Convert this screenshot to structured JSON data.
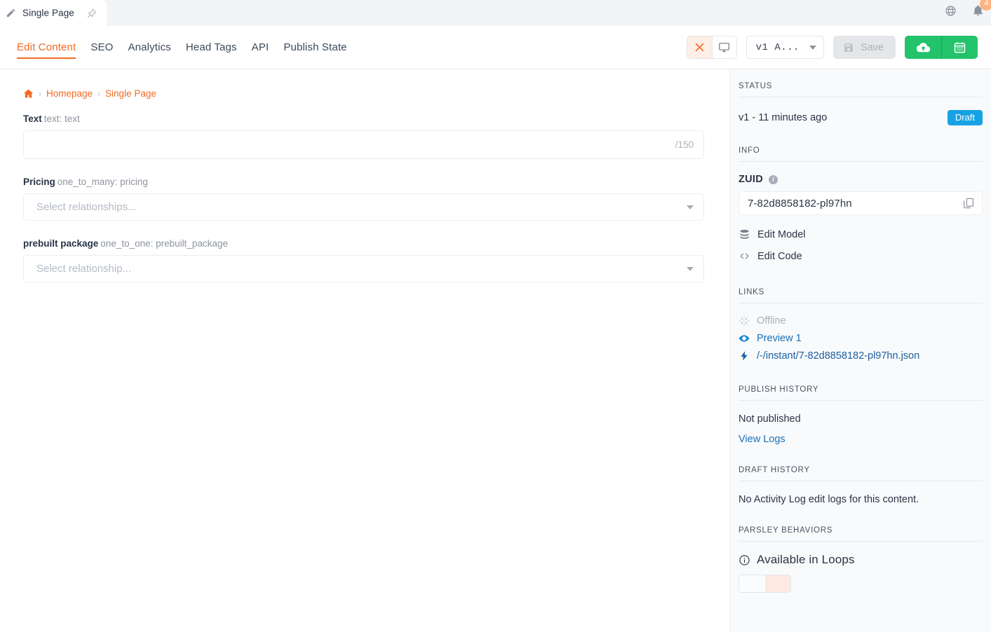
{
  "tab": {
    "label": "Single Page",
    "pencil_icon": "pencil-icon",
    "pin_icon": "pin-icon"
  },
  "header": {
    "globe_icon": "globe-icon",
    "bell_icon": "bell-icon",
    "notification_count": "4"
  },
  "toolbar": {
    "nav_tabs": [
      {
        "label": "Edit Content",
        "active": true
      },
      {
        "label": "SEO",
        "active": false
      },
      {
        "label": "Analytics",
        "active": false
      },
      {
        "label": "Head Tags",
        "active": false
      },
      {
        "label": "API",
        "active": false
      },
      {
        "label": "Publish State",
        "active": false
      }
    ],
    "close_icon": "close-x-icon",
    "device_icon": "desktop-monitor-icon",
    "version_select_label": "v1 A...",
    "save_label": "Save",
    "save_icon": "floppy-disk-icon",
    "publish_icon": "cloud-upload-icon",
    "schedule_icon": "calendar-icon"
  },
  "breadcrumb": {
    "home_icon": "home-icon",
    "items": [
      "Homepage",
      "Single Page"
    ],
    "separator": "›"
  },
  "form": {
    "fields": [
      {
        "name": "Text",
        "meta": "text: text",
        "type": "text",
        "value": "",
        "counter": "/150"
      },
      {
        "name": "Pricing",
        "meta": "one_to_many: pricing",
        "type": "select",
        "placeholder": "Select relationships..."
      },
      {
        "name": "prebuilt package",
        "meta": "one_to_one: prebuilt_package",
        "type": "select",
        "placeholder": "Select relationship..."
      }
    ]
  },
  "sidebar": {
    "status": {
      "heading": "STATUS",
      "version_text": "v1 - 11 minutes ago",
      "badge": "Draft"
    },
    "info": {
      "heading": "INFO",
      "zuid_label": "ZUID",
      "zuid_value": "7-82d8858182-pl97hn",
      "copy_icon": "copy-icon",
      "info_icon": "info-icon",
      "actions": [
        {
          "label": "Edit Model",
          "icon": "database-icon"
        },
        {
          "label": "Edit Code",
          "icon": "code-brackets-icon"
        }
      ]
    },
    "links": {
      "heading": "LINKS",
      "items": [
        {
          "label": "Offline",
          "icon": "broken-link-icon",
          "state": "disabled"
        },
        {
          "label": "Preview 1",
          "icon": "eye-icon",
          "state": "link"
        },
        {
          "label": "/-/instant/7-82d8858182-pl97hn.json",
          "icon": "lightning-bolt-icon",
          "state": "link-dark"
        }
      ]
    },
    "publish_history": {
      "heading": "PUBLISH HISTORY",
      "status": "Not published",
      "view_logs": "View Logs"
    },
    "draft_history": {
      "heading": "DRAFT HISTORY",
      "message": "No Activity Log edit logs for this content."
    },
    "parsley": {
      "heading": "PARSLEY BEHAVIORS",
      "item_label": "Available in Loops",
      "item_icon": "info-circle-icon"
    }
  },
  "colors": {
    "accent_orange": "#f26a21",
    "green": "#22c36a",
    "badge_blue": "#17a2e3",
    "link_blue": "#1570b8",
    "sidebar_bg": "#f9fafc"
  }
}
